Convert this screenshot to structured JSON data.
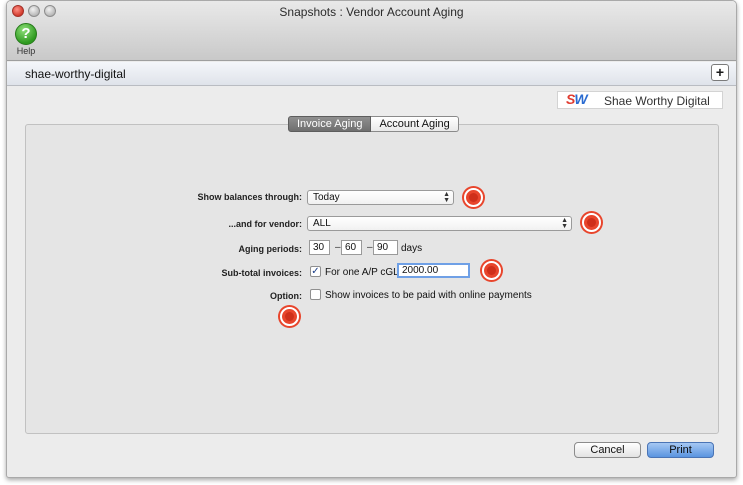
{
  "window": {
    "title": "Snapshots : Vendor Account Aging"
  },
  "toolbar": {
    "help_label": "Help",
    "help_glyph": "?"
  },
  "subbar": {
    "title": "shae-worthy-digital",
    "add_glyph": "+"
  },
  "logo": {
    "mark_s": "S",
    "mark_w": "W",
    "text": "Shae Worthy Digital"
  },
  "tabs": [
    {
      "label": "Invoice Aging",
      "active": true
    },
    {
      "label": "Account Aging",
      "active": false
    }
  ],
  "form": {
    "show_balances_label": "Show balances through:",
    "show_balances_value": "Today",
    "vendor_label": "...and for vendor:",
    "vendor_value": "ALL",
    "aging_label": "Aging periods:",
    "aging_values": [
      "30",
      "60",
      "90"
    ],
    "aging_sep": "–",
    "aging_unit": "days",
    "subtotal_label": "Sub-total invoices:",
    "subtotal_checkbox_label": "For one A/P cGL:",
    "subtotal_amount": "2000.00",
    "option_label": "Option:",
    "option_checkbox_label": "Show invoices to be paid with online payments",
    "check_glyph": "✓"
  },
  "buttons": {
    "cancel": "Cancel",
    "print": "Print"
  },
  "colors": {
    "marker": "#e8452c",
    "primary_button": "#5a94e0",
    "help_icon": "#2f9a20"
  }
}
